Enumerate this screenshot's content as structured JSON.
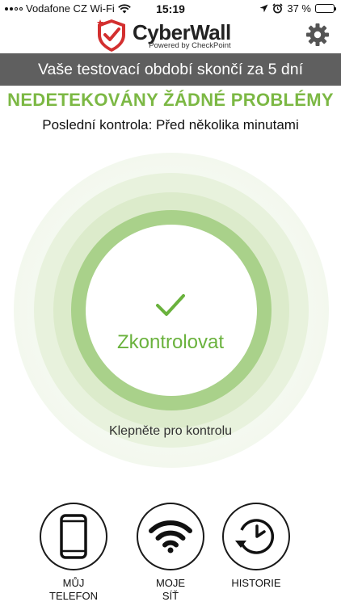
{
  "status_bar": {
    "carrier": "Vodafone CZ Wi-Fi",
    "time": "15:19",
    "battery_percent": "37 %",
    "battery_level": 0.37
  },
  "header": {
    "app_name": "CyberWall",
    "powered_by": "Powered by CheckPoint",
    "brand_color": "#d32f2f"
  },
  "banner": {
    "text": "Vaše testovací období skončí za 5 dní"
  },
  "status": {
    "title": "NEDETEKOVÁNY ŽÁDNÉ PROBLÉMY",
    "last_check": "Poslední kontrola: Před několika minutami",
    "accent_color": "#7cb844"
  },
  "scan": {
    "button_label": "Zkontrolovat",
    "hint": "Klepněte pro kontrolu",
    "icon": "checkmark-icon"
  },
  "nav": {
    "items": [
      {
        "label": "MŮJ\nTELEFON",
        "icon": "phone-icon"
      },
      {
        "label": "MOJE\nSÍŤ",
        "icon": "wifi-icon"
      },
      {
        "label": "HISTORIE",
        "icon": "history-clock-icon"
      }
    ]
  }
}
